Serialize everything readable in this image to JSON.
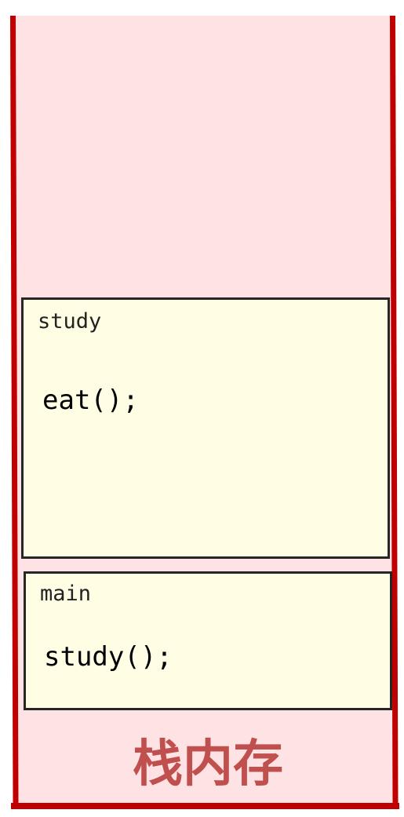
{
  "stack": {
    "label": "栈内存",
    "colors": {
      "wall": "#c00000",
      "fill": "#ffe3e4",
      "frame_fill": "#fffde3",
      "label": "#c0504d"
    },
    "frames": [
      {
        "name": "study",
        "code": "eat();"
      },
      {
        "name": "main",
        "code": "study();"
      }
    ]
  }
}
